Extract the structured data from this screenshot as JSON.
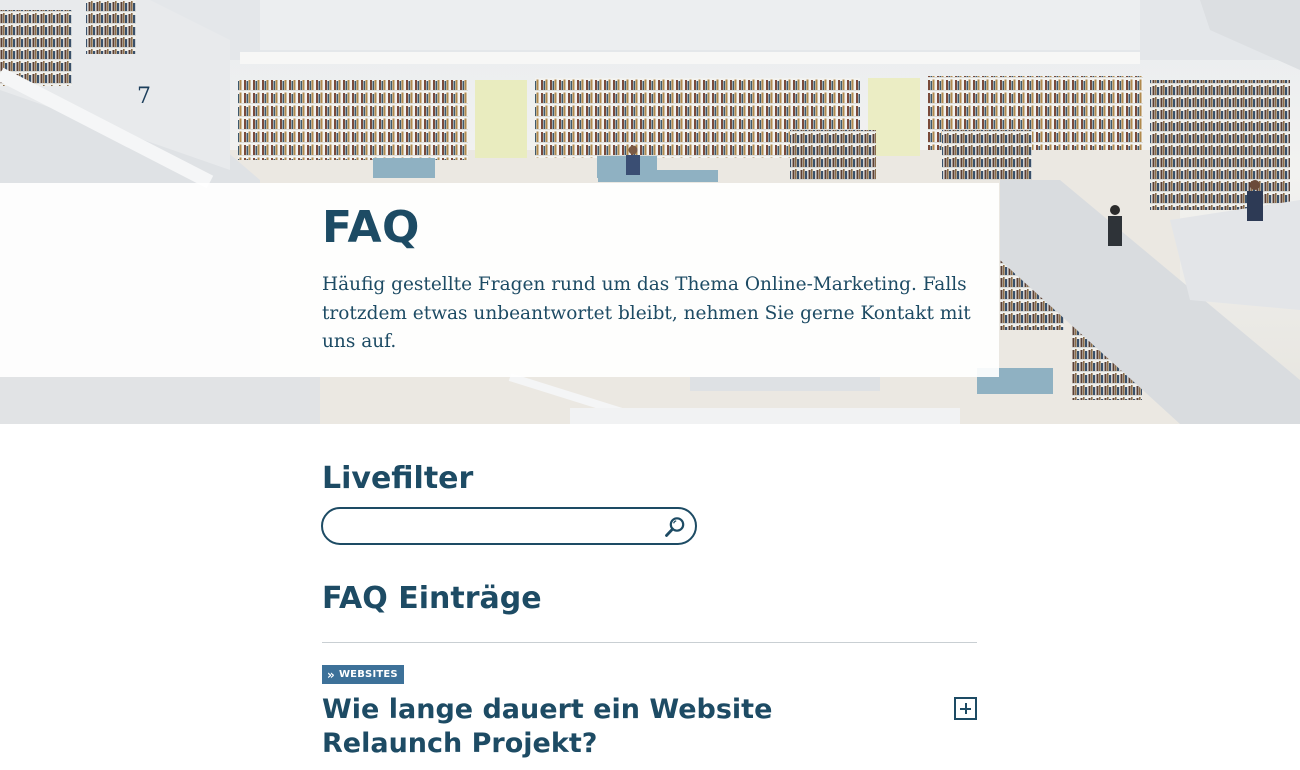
{
  "hero": {
    "title": "FAQ",
    "intro": "Häufig gestellte Fragen rund um das Thema Online-Marketing. Falls trotzdem etwas unbeantwortet bleibt, nehmen Sie gerne Kontakt mit uns auf."
  },
  "livefilter": {
    "heading": "Livefilter",
    "value": "",
    "placeholder": "",
    "search_icon": "magnifier-icon"
  },
  "entries": {
    "heading": "FAQ Einträge",
    "items": [
      {
        "category": "WEBSITES",
        "category_icon": "double-chevron-right-icon",
        "question": "Wie lange dauert ein Website Relaunch Projekt?",
        "toggle_icon": "plus-icon"
      }
    ]
  },
  "colors": {
    "primary": "#1d4b64",
    "badge": "#3d7199",
    "divider": "#c9cfd3"
  }
}
